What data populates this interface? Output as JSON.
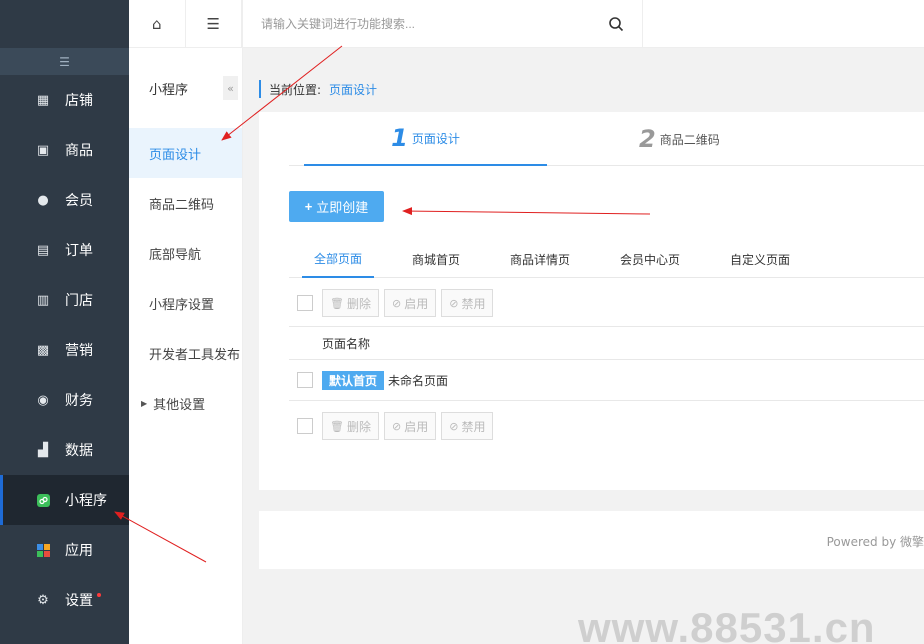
{
  "sidebar": {
    "items": [
      {
        "label": "店铺",
        "icon": "store-icon"
      },
      {
        "label": "商品",
        "icon": "goods-icon"
      },
      {
        "label": "会员",
        "icon": "user-icon"
      },
      {
        "label": "订单",
        "icon": "order-icon"
      },
      {
        "label": "门店",
        "icon": "shop-icon"
      },
      {
        "label": "营销",
        "icon": "gift-icon"
      },
      {
        "label": "财务",
        "icon": "money-bag-icon"
      },
      {
        "label": "数据",
        "icon": "chart-icon"
      },
      {
        "label": "小程序",
        "icon": "miniprogram-icon",
        "active": true
      },
      {
        "label": "应用",
        "icon": "apps-icon"
      },
      {
        "label": "设置",
        "icon": "gear-icon",
        "badge_dot": true
      }
    ]
  },
  "subnav": {
    "title": "小程序",
    "fold_glyph": "«",
    "items": [
      {
        "label": "页面设计",
        "active": true
      },
      {
        "label": "商品二维码"
      },
      {
        "label": "底部导航"
      },
      {
        "label": "小程序设置"
      },
      {
        "label": "开发者工具发布"
      },
      {
        "label": "其他设置",
        "expandable": true
      }
    ]
  },
  "header": {
    "search_placeholder": "请输入关键词进行功能搜索..."
  },
  "breadcrumb": {
    "label": "当前位置:",
    "current": "页面设计"
  },
  "steps": [
    {
      "num": "1",
      "label": "页面设计",
      "active": true
    },
    {
      "num": "2",
      "label": "商品二维码"
    }
  ],
  "create_button": {
    "label": "立即创建"
  },
  "tabs": [
    "全部页面",
    "商城首页",
    "商品详情页",
    "会员中心页",
    "自定义页面"
  ],
  "toolbar": {
    "delete": "删除",
    "enable": "启用",
    "disable": "禁用"
  },
  "table": {
    "header": "页面名称",
    "rows": [
      {
        "badge": "默认首页",
        "name": "未命名页面"
      }
    ]
  },
  "footer": {
    "powered": "Powered by 微擎"
  },
  "watermark": "www.88531.cn",
  "colors": {
    "accent": "#2d8ce6",
    "button": "#4eaaf0",
    "sidebar_bg": "#2f3a46",
    "annotation_arrow": "#e02020"
  }
}
